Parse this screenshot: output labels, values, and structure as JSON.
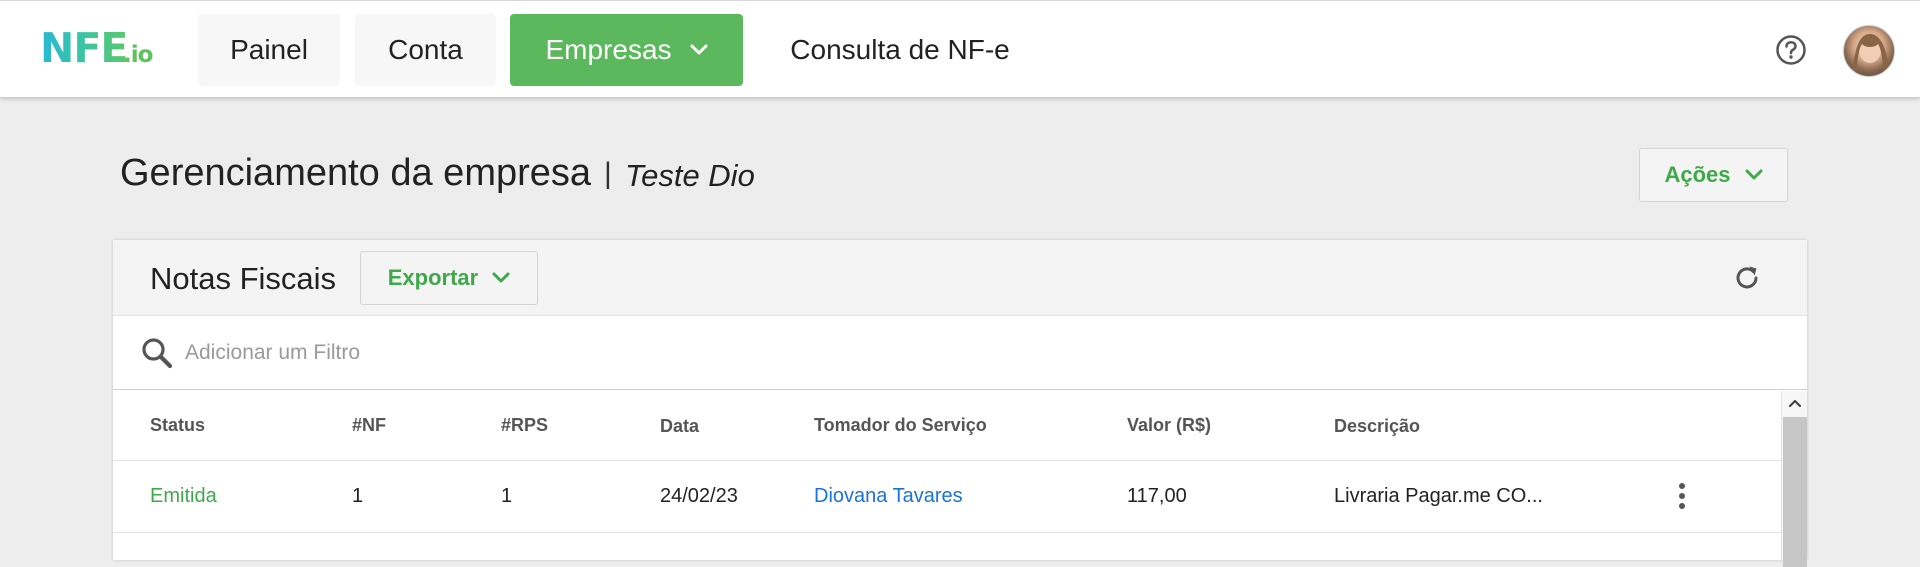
{
  "nav": {
    "logo_main": "NFE",
    "logo_suffix": ".io",
    "items": [
      {
        "label": "Painel"
      },
      {
        "label": "Conta"
      },
      {
        "label": "Empresas"
      },
      {
        "label": "Consulta de NF-e"
      }
    ],
    "active_color": "#5cb85c"
  },
  "page": {
    "title": "Gerenciamento da empresa",
    "separator": "|",
    "company": "Teste Dio",
    "actions_label": "Ações"
  },
  "card": {
    "title": "Notas Fiscais",
    "export_label": "Exportar",
    "filter_placeholder": "Adicionar um Filtro",
    "filter_value": ""
  },
  "table": {
    "columns": [
      "Status",
      "#NF",
      "#RPS",
      "Data",
      "Tomador do Serviço",
      "Valor (R$)",
      "Descrição"
    ],
    "rows": [
      {
        "status": "Emitida",
        "nf": "1",
        "rps": "1",
        "data": "24/02/23",
        "tomador": "Diovana Tavares",
        "valor": "117,00",
        "descricao": "Livraria Pagar.me CO..."
      }
    ]
  },
  "colors": {
    "accent_green": "#3fa84a",
    "link_blue": "#1a73d6",
    "background": "#ededed"
  },
  "icons": [
    "help-circle-icon",
    "avatar",
    "chevron-down-icon",
    "refresh-icon",
    "search-icon",
    "kebab-menu-icon",
    "scroll-up-icon"
  ]
}
